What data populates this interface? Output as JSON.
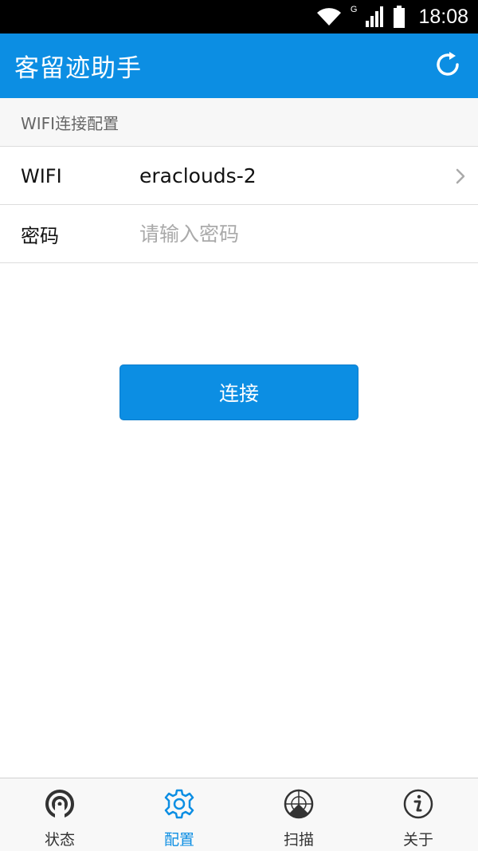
{
  "status_bar": {
    "network_label": "G",
    "time": "18:08",
    "icons": [
      "wifi-icon",
      "signal-icon",
      "battery-icon"
    ]
  },
  "app_bar": {
    "title": "客留迹助手",
    "action_icon": "refresh-icon"
  },
  "section": {
    "header": "WIFI连接配置"
  },
  "form": {
    "wifi_label": "WIFI",
    "wifi_value": "eraclouds-2",
    "password_label": "密码",
    "password_value": "",
    "password_placeholder": "请输入密码"
  },
  "connect_button": {
    "label": "连接"
  },
  "bottom_nav": {
    "items": [
      {
        "label": "状态",
        "icon": "broadcast-icon",
        "active": false
      },
      {
        "label": "配置",
        "icon": "gear-icon",
        "active": true
      },
      {
        "label": "扫描",
        "icon": "radar-icon",
        "active": false
      },
      {
        "label": "关于",
        "icon": "info-icon",
        "active": false
      }
    ]
  },
  "colors": {
    "primary": "#0c8ee3",
    "status_bar": "#000000",
    "section_bg": "#f7f7f7",
    "divider": "#dddddd",
    "placeholder": "#aaaaaa",
    "nav_inactive": "#333333"
  }
}
